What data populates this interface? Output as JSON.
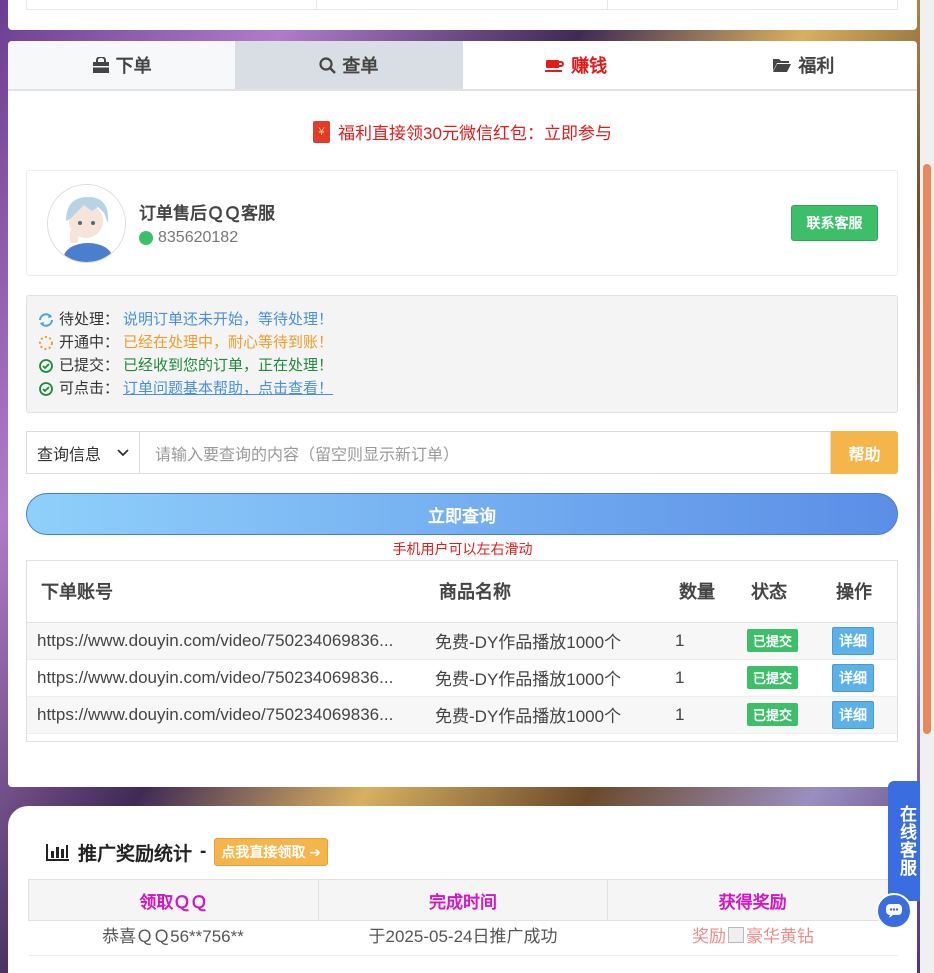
{
  "tabs": [
    {
      "label": "下单",
      "icon": "shopping-bag-icon"
    },
    {
      "label": "查单",
      "icon": "search-icon"
    },
    {
      "label": "赚钱",
      "icon": "coffee-cup-icon"
    },
    {
      "label": "福利",
      "icon": "folder-open-icon"
    }
  ],
  "promo": {
    "text": "福利直接领30元微信红包：立即参与",
    "icon_char": "¥"
  },
  "customer_service": {
    "name": "订单售后ＱＱ客服",
    "qq": "835620182",
    "button": "联系客服"
  },
  "notice": [
    {
      "label": "待处理：",
      "text": "说明订单还未开始，等待处理！",
      "color": "#4a8fe0"
    },
    {
      "label": "开通中：",
      "text": "已经在处理中，耐心等待到账！",
      "color": "#f29c2b"
    },
    {
      "label": "已提交：",
      "text": "已经收到您的订单，正在处理！",
      "color": "#1f8a3a"
    },
    {
      "label": "可点击：",
      "text": "订单问题基本帮助，点击查看！",
      "color": "#4a8fe0"
    }
  ],
  "search": {
    "select_value": "查询信息",
    "placeholder": "请输入要查询的内容（留空则显示新订单）",
    "help_button": "帮助",
    "query_button": "立即查询",
    "mobile_tip": "手机用户可以左右滑动"
  },
  "orders_table": {
    "headers": [
      "下单账号",
      "商品名称",
      "数量",
      "状态",
      "操作"
    ],
    "rows": [
      {
        "account": "https://www.douyin.com/video/750234069836...",
        "product": "免费-DY作品播放1000个",
        "qty": "1",
        "status": "已提交",
        "action": "详细"
      },
      {
        "account": "https://www.douyin.com/video/750234069836...",
        "product": "免费-DY作品播放1000个",
        "qty": "1",
        "status": "已提交",
        "action": "详细"
      },
      {
        "account": "https://www.douyin.com/video/750234069836...",
        "product": "免费-DY作品播放1000个",
        "qty": "1",
        "status": "已提交",
        "action": "详细"
      }
    ]
  },
  "promotion_stats": {
    "title": "推广奖励统计",
    "separator": "-",
    "claim_button": "点我直接领取",
    "headers": [
      "领取ＱＱ",
      "完成时间",
      "获得奖励"
    ],
    "row": {
      "qq": "恭喜ＱＱ56**756**",
      "time": "于2025-05-24日推广成功",
      "reward": "奖励",
      "reward_alt": "豪华黄钻"
    }
  },
  "side_service": {
    "label": "在线客服"
  }
}
